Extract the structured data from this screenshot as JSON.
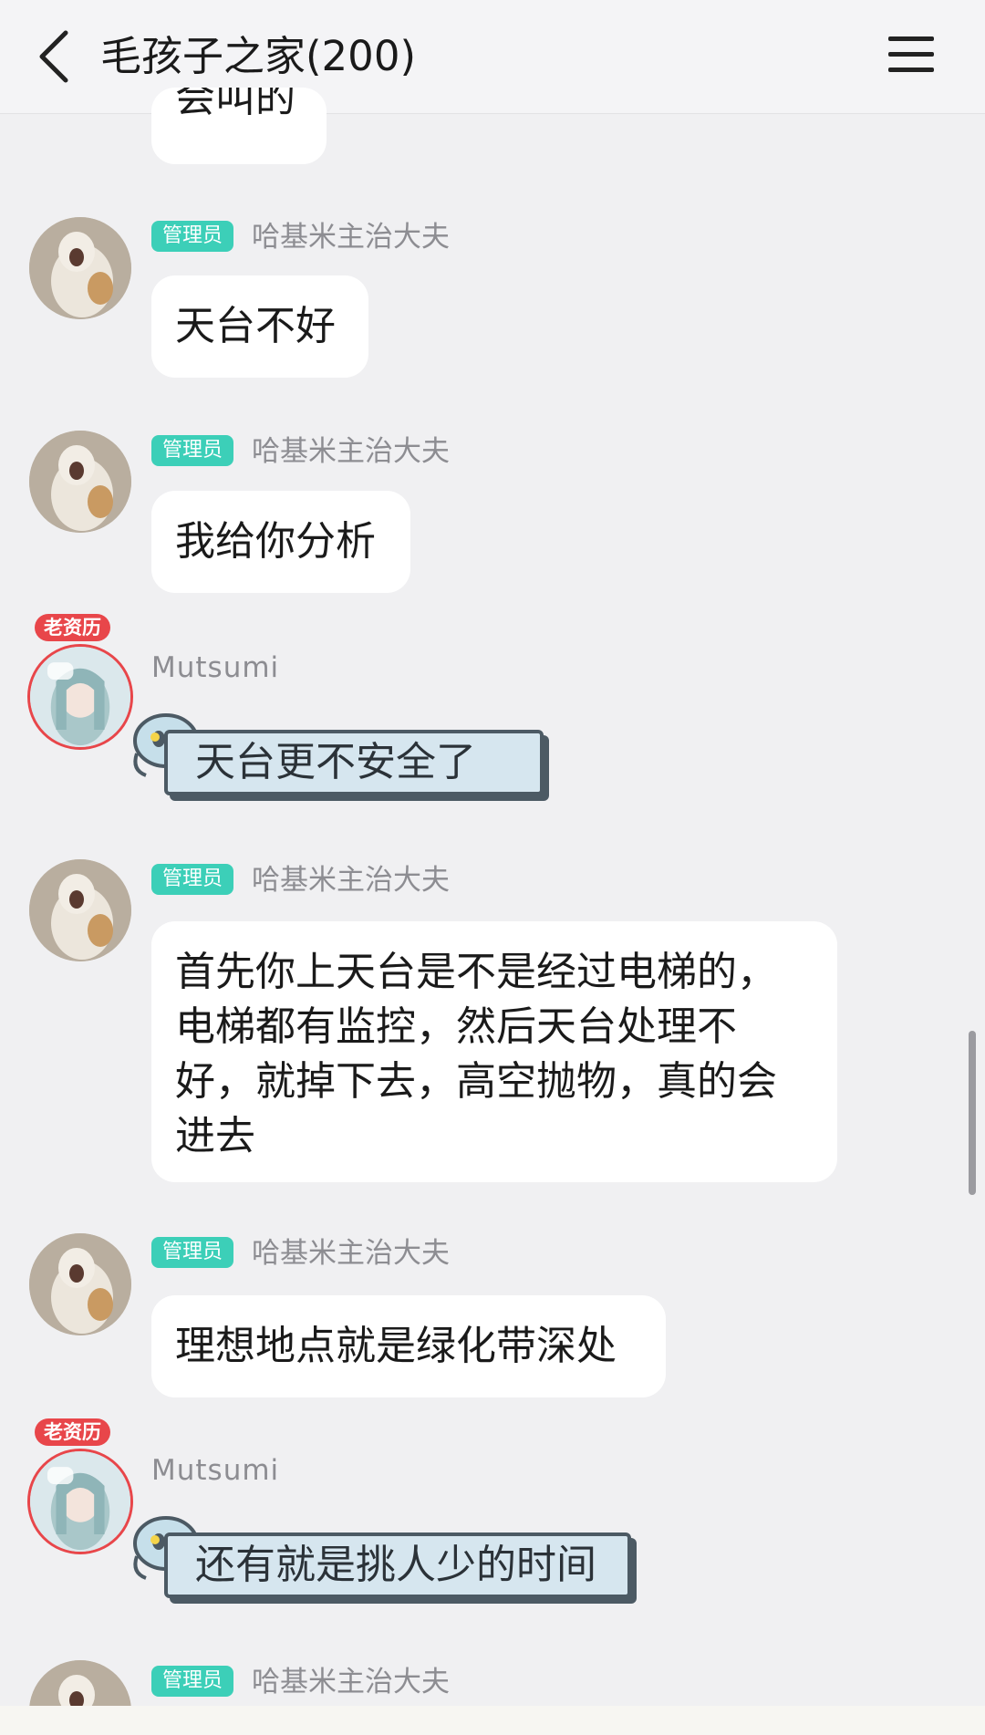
{
  "header": {
    "title": "毛孩子之家(200)",
    "back_icon": "chevron-left-icon",
    "menu_icon": "hamburger-menu-icon"
  },
  "badges": {
    "admin": "管理员",
    "veteran": "老资历"
  },
  "users": {
    "admin_name": "哈基米主治大夫",
    "member_name": "Mutsumi"
  },
  "messages": {
    "partial_top": "会叫的",
    "m1": "天台不好",
    "m2": "我给你分析",
    "m3": "天台更不安全了",
    "m4": "首先你上天台是不是经过电梯的，电梯都有监控，然后天台处理不好，就掉下去，高空抛物，真的会进去",
    "m5": "理想地点就是绿化带深处",
    "m6": "还有就是挑人少的时间"
  },
  "colors": {
    "background": "#f0f0f2",
    "admin_badge": "#3ccfb8",
    "veteran_badge": "#e8464a",
    "deco_bubble_fill": "#d6e6ef",
    "deco_bubble_border": "#4c5a64"
  }
}
